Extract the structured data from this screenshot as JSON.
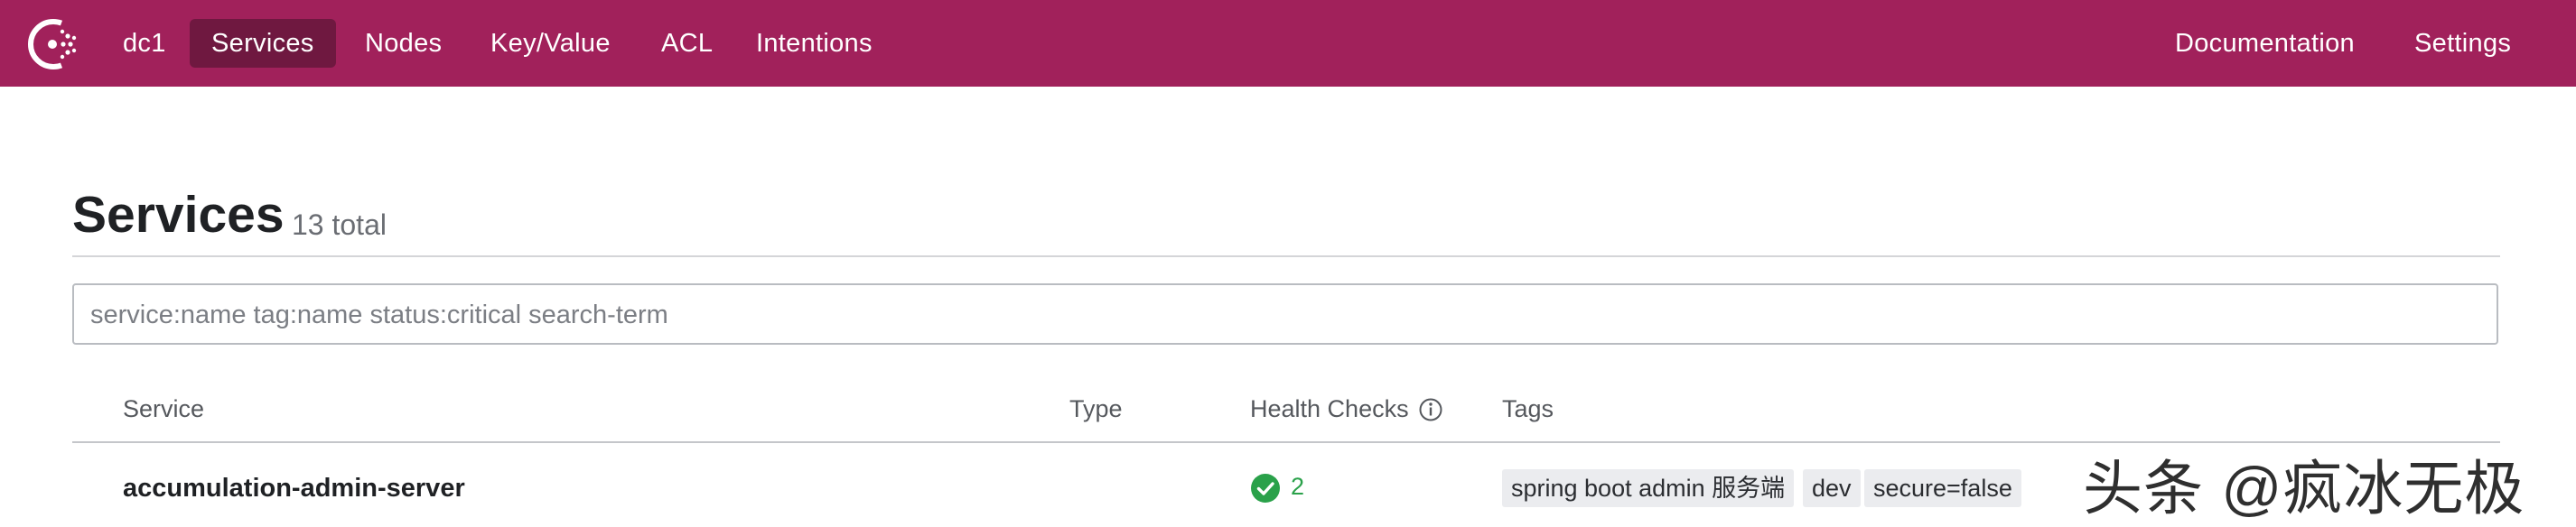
{
  "topbar": {
    "logo": "consul-logo-icon",
    "datacenter": "dc1",
    "nav": [
      {
        "label": "Services",
        "active": true
      },
      {
        "label": "Nodes",
        "active": false
      },
      {
        "label": "Key/Value",
        "active": false
      },
      {
        "label": "ACL",
        "active": false
      },
      {
        "label": "Intentions",
        "active": false
      }
    ],
    "right": [
      {
        "label": "Documentation"
      },
      {
        "label": "Settings"
      }
    ],
    "colors": {
      "background": "#a1215b",
      "active": "#6f1840"
    }
  },
  "page": {
    "title": "Services",
    "count": "13 total"
  },
  "search": {
    "placeholder": "service:name tag:name status:critical search-term"
  },
  "table": {
    "headers": {
      "service": "Service",
      "type": "Type",
      "health": "Health Checks",
      "tags": "Tags"
    },
    "info_icon": "info-icon",
    "rows": [
      {
        "service": "accumulation-admin-server",
        "type": "",
        "health_icon": "check-circle-icon",
        "health_passing": "2",
        "tags": [
          "spring boot admin 服务端",
          "dev",
          "secure=false"
        ]
      }
    ]
  },
  "watermark": {
    "text": "头条 @疯冰无极"
  }
}
